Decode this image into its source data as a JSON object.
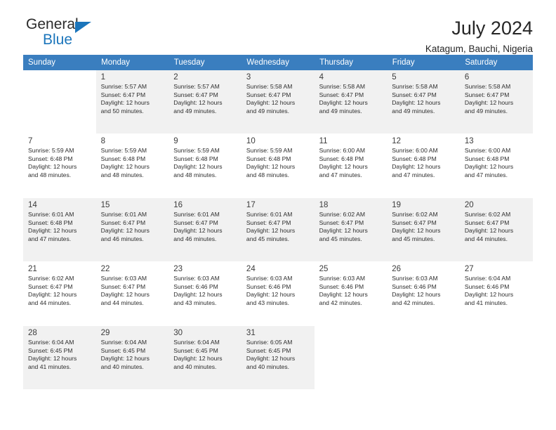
{
  "brand": {
    "name_part1": "General",
    "name_part2": "Blue",
    "triangle_color": "#1b75bb"
  },
  "header": {
    "title": "July 2024",
    "subtitle": "Katagum, Bauchi, Nigeria",
    "header_bg": "#3a7ebf"
  },
  "weekdays": [
    "Sunday",
    "Monday",
    "Tuesday",
    "Wednesday",
    "Thursday",
    "Friday",
    "Saturday"
  ],
  "weeks": [
    [
      {
        "day": "",
        "sunrise": "",
        "sunset": "",
        "daylight1": "",
        "daylight2": ""
      },
      {
        "day": "1",
        "sunrise": "Sunrise: 5:57 AM",
        "sunset": "Sunset: 6:47 PM",
        "daylight1": "Daylight: 12 hours",
        "daylight2": "and 50 minutes."
      },
      {
        "day": "2",
        "sunrise": "Sunrise: 5:57 AM",
        "sunset": "Sunset: 6:47 PM",
        "daylight1": "Daylight: 12 hours",
        "daylight2": "and 49 minutes."
      },
      {
        "day": "3",
        "sunrise": "Sunrise: 5:58 AM",
        "sunset": "Sunset: 6:47 PM",
        "daylight1": "Daylight: 12 hours",
        "daylight2": "and 49 minutes."
      },
      {
        "day": "4",
        "sunrise": "Sunrise: 5:58 AM",
        "sunset": "Sunset: 6:47 PM",
        "daylight1": "Daylight: 12 hours",
        "daylight2": "and 49 minutes."
      },
      {
        "day": "5",
        "sunrise": "Sunrise: 5:58 AM",
        "sunset": "Sunset: 6:47 PM",
        "daylight1": "Daylight: 12 hours",
        "daylight2": "and 49 minutes."
      },
      {
        "day": "6",
        "sunrise": "Sunrise: 5:58 AM",
        "sunset": "Sunset: 6:47 PM",
        "daylight1": "Daylight: 12 hours",
        "daylight2": "and 49 minutes."
      }
    ],
    [
      {
        "day": "7",
        "sunrise": "Sunrise: 5:59 AM",
        "sunset": "Sunset: 6:48 PM",
        "daylight1": "Daylight: 12 hours",
        "daylight2": "and 48 minutes."
      },
      {
        "day": "8",
        "sunrise": "Sunrise: 5:59 AM",
        "sunset": "Sunset: 6:48 PM",
        "daylight1": "Daylight: 12 hours",
        "daylight2": "and 48 minutes."
      },
      {
        "day": "9",
        "sunrise": "Sunrise: 5:59 AM",
        "sunset": "Sunset: 6:48 PM",
        "daylight1": "Daylight: 12 hours",
        "daylight2": "and 48 minutes."
      },
      {
        "day": "10",
        "sunrise": "Sunrise: 5:59 AM",
        "sunset": "Sunset: 6:48 PM",
        "daylight1": "Daylight: 12 hours",
        "daylight2": "and 48 minutes."
      },
      {
        "day": "11",
        "sunrise": "Sunrise: 6:00 AM",
        "sunset": "Sunset: 6:48 PM",
        "daylight1": "Daylight: 12 hours",
        "daylight2": "and 47 minutes."
      },
      {
        "day": "12",
        "sunrise": "Sunrise: 6:00 AM",
        "sunset": "Sunset: 6:48 PM",
        "daylight1": "Daylight: 12 hours",
        "daylight2": "and 47 minutes."
      },
      {
        "day": "13",
        "sunrise": "Sunrise: 6:00 AM",
        "sunset": "Sunset: 6:48 PM",
        "daylight1": "Daylight: 12 hours",
        "daylight2": "and 47 minutes."
      }
    ],
    [
      {
        "day": "14",
        "sunrise": "Sunrise: 6:01 AM",
        "sunset": "Sunset: 6:48 PM",
        "daylight1": "Daylight: 12 hours",
        "daylight2": "and 47 minutes."
      },
      {
        "day": "15",
        "sunrise": "Sunrise: 6:01 AM",
        "sunset": "Sunset: 6:47 PM",
        "daylight1": "Daylight: 12 hours",
        "daylight2": "and 46 minutes."
      },
      {
        "day": "16",
        "sunrise": "Sunrise: 6:01 AM",
        "sunset": "Sunset: 6:47 PM",
        "daylight1": "Daylight: 12 hours",
        "daylight2": "and 46 minutes."
      },
      {
        "day": "17",
        "sunrise": "Sunrise: 6:01 AM",
        "sunset": "Sunset: 6:47 PM",
        "daylight1": "Daylight: 12 hours",
        "daylight2": "and 45 minutes."
      },
      {
        "day": "18",
        "sunrise": "Sunrise: 6:02 AM",
        "sunset": "Sunset: 6:47 PM",
        "daylight1": "Daylight: 12 hours",
        "daylight2": "and 45 minutes."
      },
      {
        "day": "19",
        "sunrise": "Sunrise: 6:02 AM",
        "sunset": "Sunset: 6:47 PM",
        "daylight1": "Daylight: 12 hours",
        "daylight2": "and 45 minutes."
      },
      {
        "day": "20",
        "sunrise": "Sunrise: 6:02 AM",
        "sunset": "Sunset: 6:47 PM",
        "daylight1": "Daylight: 12 hours",
        "daylight2": "and 44 minutes."
      }
    ],
    [
      {
        "day": "21",
        "sunrise": "Sunrise: 6:02 AM",
        "sunset": "Sunset: 6:47 PM",
        "daylight1": "Daylight: 12 hours",
        "daylight2": "and 44 minutes."
      },
      {
        "day": "22",
        "sunrise": "Sunrise: 6:03 AM",
        "sunset": "Sunset: 6:47 PM",
        "daylight1": "Daylight: 12 hours",
        "daylight2": "and 44 minutes."
      },
      {
        "day": "23",
        "sunrise": "Sunrise: 6:03 AM",
        "sunset": "Sunset: 6:46 PM",
        "daylight1": "Daylight: 12 hours",
        "daylight2": "and 43 minutes."
      },
      {
        "day": "24",
        "sunrise": "Sunrise: 6:03 AM",
        "sunset": "Sunset: 6:46 PM",
        "daylight1": "Daylight: 12 hours",
        "daylight2": "and 43 minutes."
      },
      {
        "day": "25",
        "sunrise": "Sunrise: 6:03 AM",
        "sunset": "Sunset: 6:46 PM",
        "daylight1": "Daylight: 12 hours",
        "daylight2": "and 42 minutes."
      },
      {
        "day": "26",
        "sunrise": "Sunrise: 6:03 AM",
        "sunset": "Sunset: 6:46 PM",
        "daylight1": "Daylight: 12 hours",
        "daylight2": "and 42 minutes."
      },
      {
        "day": "27",
        "sunrise": "Sunrise: 6:04 AM",
        "sunset": "Sunset: 6:46 PM",
        "daylight1": "Daylight: 12 hours",
        "daylight2": "and 41 minutes."
      }
    ],
    [
      {
        "day": "28",
        "sunrise": "Sunrise: 6:04 AM",
        "sunset": "Sunset: 6:45 PM",
        "daylight1": "Daylight: 12 hours",
        "daylight2": "and 41 minutes."
      },
      {
        "day": "29",
        "sunrise": "Sunrise: 6:04 AM",
        "sunset": "Sunset: 6:45 PM",
        "daylight1": "Daylight: 12 hours",
        "daylight2": "and 40 minutes."
      },
      {
        "day": "30",
        "sunrise": "Sunrise: 6:04 AM",
        "sunset": "Sunset: 6:45 PM",
        "daylight1": "Daylight: 12 hours",
        "daylight2": "and 40 minutes."
      },
      {
        "day": "31",
        "sunrise": "Sunrise: 6:05 AM",
        "sunset": "Sunset: 6:45 PM",
        "daylight1": "Daylight: 12 hours",
        "daylight2": "and 40 minutes."
      },
      {
        "day": "",
        "sunrise": "",
        "sunset": "",
        "daylight1": "",
        "daylight2": ""
      },
      {
        "day": "",
        "sunrise": "",
        "sunset": "",
        "daylight1": "",
        "daylight2": ""
      },
      {
        "day": "",
        "sunrise": "",
        "sunset": "",
        "daylight1": "",
        "daylight2": ""
      }
    ]
  ]
}
